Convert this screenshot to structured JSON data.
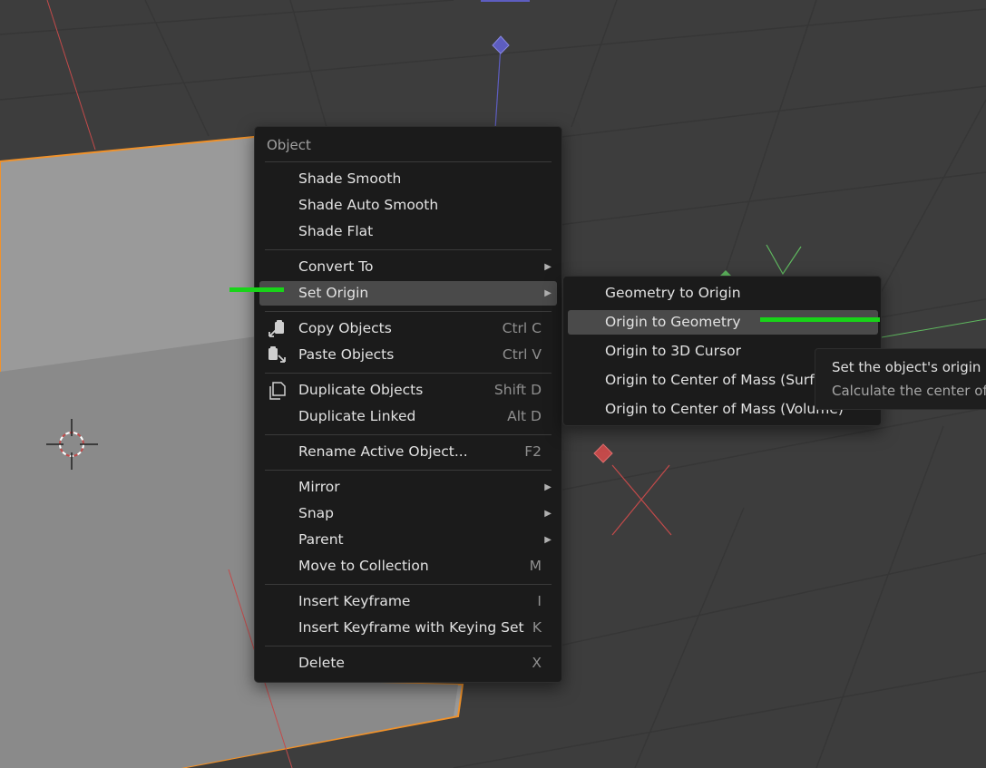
{
  "colors": {
    "background": "#3d3d3d",
    "menu_bg": "#1b1b1b",
    "highlight": "#4a4a4a",
    "selection_outline": "#f0922b",
    "axis_x": "#c34a4a",
    "axis_z": "#5d5dc0",
    "axis_y": "#5fb85f",
    "annotation": "#19d319"
  },
  "main_menu": {
    "title": "Object",
    "items": [
      {
        "label": "Shade Smooth",
        "shortcut": ""
      },
      {
        "label": "Shade Auto Smooth",
        "shortcut": ""
      },
      {
        "label": "Shade Flat",
        "shortcut": ""
      },
      {
        "label": "Convert To",
        "shortcut": "",
        "submenu": true
      },
      {
        "label": "Set Origin",
        "shortcut": "",
        "submenu": true,
        "highlighted": true
      },
      {
        "label": "Copy Objects",
        "shortcut": "Ctrl C",
        "icon": "copy-icon"
      },
      {
        "label": "Paste Objects",
        "shortcut": "Ctrl V",
        "icon": "paste-icon"
      },
      {
        "label": "Duplicate Objects",
        "shortcut": "Shift D",
        "icon": "duplicate-icon"
      },
      {
        "label": "Duplicate Linked",
        "shortcut": "Alt D"
      },
      {
        "label": "Rename Active Object...",
        "shortcut": "F2"
      },
      {
        "label": "Mirror",
        "shortcut": "",
        "submenu": true
      },
      {
        "label": "Snap",
        "shortcut": "",
        "submenu": true
      },
      {
        "label": "Parent",
        "shortcut": "",
        "submenu": true
      },
      {
        "label": "Move to Collection",
        "shortcut": "M"
      },
      {
        "label": "Insert Keyframe",
        "shortcut": "I"
      },
      {
        "label": "Insert Keyframe with Keying Set",
        "shortcut": "K"
      },
      {
        "label": "Delete",
        "shortcut": "X"
      }
    ]
  },
  "submenu": {
    "items": [
      {
        "label": "Geometry to Origin"
      },
      {
        "label": "Origin to Geometry",
        "highlighted": true
      },
      {
        "label": "Origin to 3D Cursor"
      },
      {
        "label": "Origin to Center of Mass (Surface)"
      },
      {
        "label": "Origin to Center of Mass (Volume)"
      }
    ]
  },
  "tooltip": {
    "line1": "Set the object's origin",
    "line2": "Calculate the center of"
  }
}
